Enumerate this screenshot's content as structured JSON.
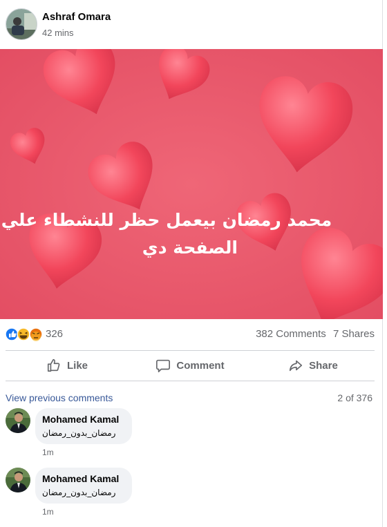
{
  "post": {
    "author": "Ashraf Omara",
    "time": "42 mins",
    "image_text_line1": "محمد رمضان بيعمل حظر للنشطاء علي",
    "image_text_line2": "الصفحة دي",
    "image_colors": {
      "background": "#e8566b",
      "heart": "#f0475c"
    }
  },
  "stats": {
    "reactions_count": "326",
    "reaction_icons": [
      "like-icon",
      "haha-icon",
      "angry-icon"
    ],
    "comments": "382 Comments",
    "shares": "7 Shares"
  },
  "actions": {
    "like": "Like",
    "comment": "Comment",
    "share": "Share"
  },
  "comments_section": {
    "view_previous": "View previous comments",
    "pager": "2 of 376",
    "items": [
      {
        "name": "Mohamed Kamal",
        "text": "رمضان_بدون_رمضان",
        "time": "1m"
      },
      {
        "name": "Mohamed Kamal",
        "text": "رمضان_بدون_رمضان",
        "time": "1m"
      }
    ]
  },
  "theme": {
    "link": "#385898",
    "muted": "#65676b",
    "like_blue": "#1877f2"
  }
}
